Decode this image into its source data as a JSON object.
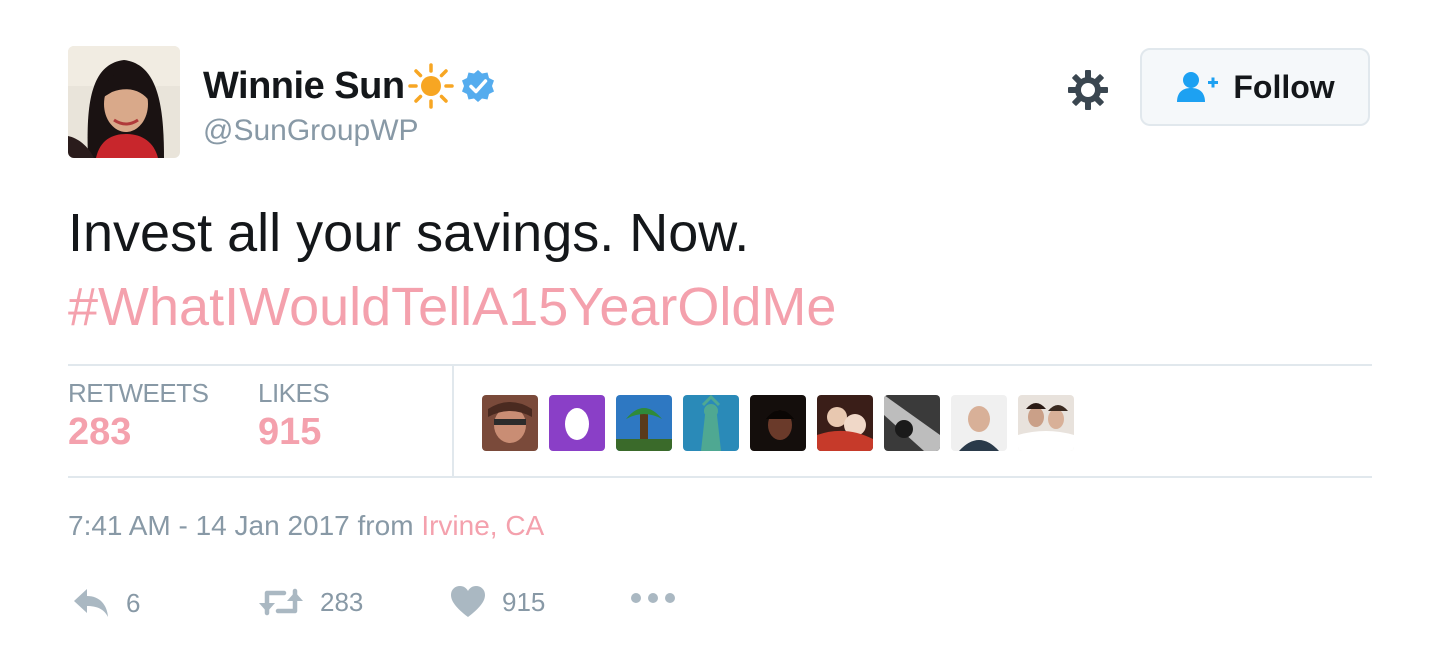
{
  "author": {
    "display_name": "Winnie Sun",
    "handle": "@SunGroupWP",
    "verified": true
  },
  "header": {
    "follow_label": "Follow"
  },
  "tweet": {
    "text": "Invest all your savings. Now.",
    "hashtag": "#WhatIWouldTellA15YearOldMe"
  },
  "stats": {
    "retweets_label": "RETWEETS",
    "retweets_count": "283",
    "likes_label": "LIKES",
    "likes_count": "915"
  },
  "meta": {
    "timestamp": "7:41 AM - 14 Jan 2017",
    "from_word": "from",
    "location": "Irvine, CA"
  },
  "actions": {
    "reply_count": "6",
    "retweet_count": "283",
    "like_count": "915"
  },
  "icons": {
    "gear": "gear-icon",
    "follow": "add-user-icon",
    "verified": "verified-badge-icon",
    "sun_emoji": "sun-emoji-icon",
    "reply": "reply-icon",
    "retweet": "retweet-icon",
    "like": "heart-icon",
    "more": "more-dots-icon"
  },
  "colors": {
    "link_accent": "#f4a1ad",
    "verified_blue": "#1da1f2",
    "muted_text": "#8899a6",
    "divider": "#e1e8ed"
  }
}
